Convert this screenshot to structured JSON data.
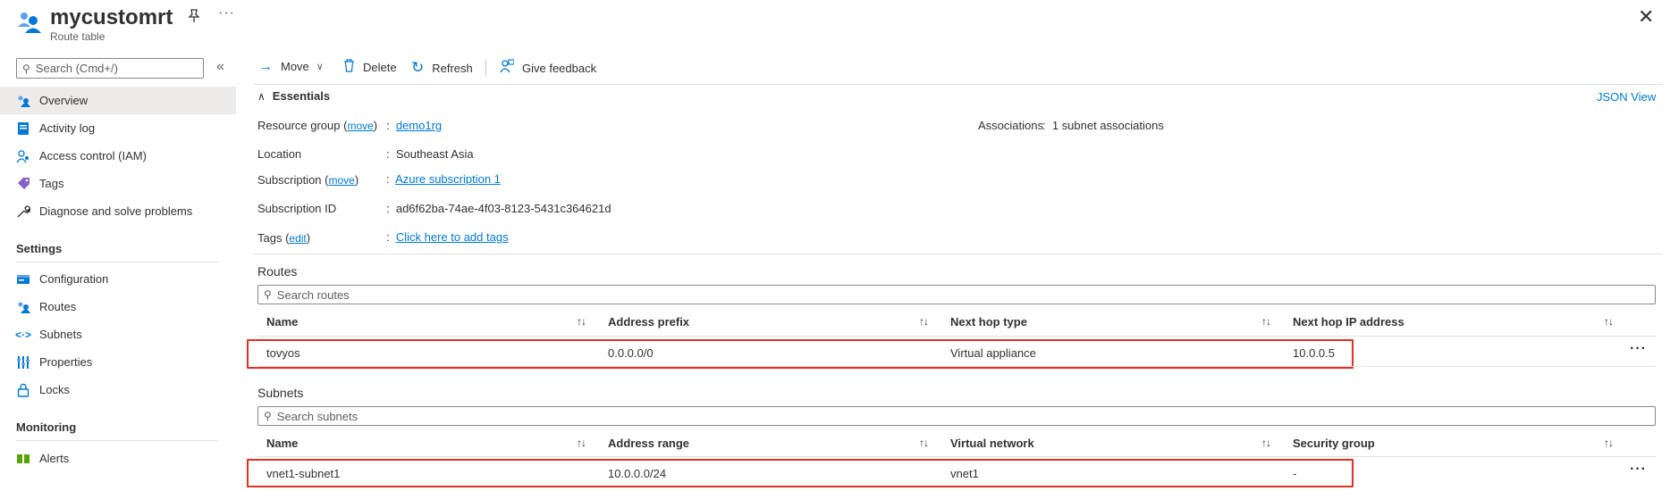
{
  "header": {
    "title": "mycustomrt",
    "subtitle": "Route table",
    "pin_icon": "pin-icon",
    "more_label": "···",
    "close_label": "✕"
  },
  "sidebar": {
    "search_placeholder": "Search (Cmd+/)",
    "collapse_label": "«",
    "items": [
      {
        "label": "Overview",
        "icon": "overview-icon",
        "active": true
      },
      {
        "label": "Activity log",
        "icon": "activity-log-icon"
      },
      {
        "label": "Access control (IAM)",
        "icon": "iam-icon"
      },
      {
        "label": "Tags",
        "icon": "tag-icon"
      },
      {
        "label": "Diagnose and solve problems",
        "icon": "wrench-icon"
      }
    ],
    "settings_heading": "Settings",
    "settings_items": [
      {
        "label": "Configuration",
        "icon": "configuration-icon"
      },
      {
        "label": "Routes",
        "icon": "routes-icon"
      },
      {
        "label": "Subnets",
        "icon": "subnets-icon"
      },
      {
        "label": "Properties",
        "icon": "properties-icon"
      },
      {
        "label": "Locks",
        "icon": "lock-icon"
      }
    ],
    "monitoring_heading": "Monitoring",
    "monitoring_items": [
      {
        "label": "Alerts",
        "icon": "alerts-icon"
      }
    ]
  },
  "toolbar": {
    "move_label": "Move",
    "delete_label": "Delete",
    "refresh_label": "Refresh",
    "feedback_label": "Give feedback"
  },
  "essentials": {
    "title": "Essentials",
    "json_view": "JSON View",
    "resource_group_label": "Resource group",
    "move_link": "move",
    "resource_group_value": "demo1rg",
    "location_label": "Location",
    "location_value": "Southeast Asia",
    "subscription_label": "Subscription",
    "subscription_value": "Azure subscription 1",
    "subscription_id_label": "Subscription ID",
    "subscription_id_value": "ad6f62ba-74ae-4f03-8123-5431c364621d",
    "tags_label": "Tags",
    "edit_link": "edit",
    "tags_value": "Click here to add tags",
    "associations_label": "Associations",
    "associations_value": "1 subnet associations"
  },
  "routes": {
    "title": "Routes",
    "search_placeholder": "Search routes",
    "columns": [
      "Name",
      "Address prefix",
      "Next hop type",
      "Next hop IP address"
    ],
    "rows": [
      {
        "name": "tovyos",
        "prefix": "0.0.0.0/0",
        "hop_type": "Virtual appliance",
        "hop_ip": "10.0.0.5"
      }
    ]
  },
  "subnets": {
    "title": "Subnets",
    "search_placeholder": "Search subnets",
    "columns": [
      "Name",
      "Address range",
      "Virtual network",
      "Security group"
    ],
    "rows": [
      {
        "name": "vnet1-subnet1",
        "range": "10.0.0.0/24",
        "vnet": "vnet1",
        "nsg": "-"
      }
    ]
  },
  "colors": {
    "accent": "#0078d4",
    "highlight": "#e0302a"
  }
}
